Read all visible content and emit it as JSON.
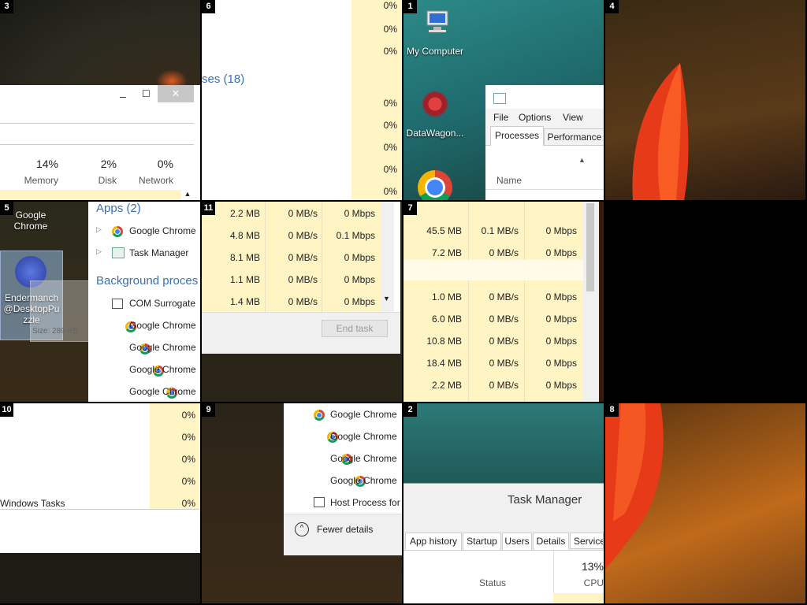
{
  "tiles": {
    "t3": {
      "num": "3",
      "memory_pct": "14%",
      "memory_label": "Memory",
      "disk_pct": "2%",
      "disk_label": "Disk",
      "network_pct": "0%",
      "network_label": "Network"
    },
    "t6": {
      "num": "6",
      "section": "ses (18)",
      "pcts": [
        "0%",
        "0%",
        "0%",
        "0%",
        "0%",
        "0%",
        "0%",
        "0%"
      ]
    },
    "t1": {
      "num": "1",
      "my_computer": "My Computer",
      "datawagon": "DataWagon...",
      "menu": [
        "File",
        "Options",
        "View"
      ],
      "tabs": [
        "Processes",
        "Performance"
      ],
      "name_col": "Name"
    },
    "t4": {
      "num": "4"
    },
    "t5": {
      "num": "5",
      "chrome_label": "Google\nChrome",
      "ender_label": "Endermanch @DesktopPuzzle",
      "apps_header": "Apps (2)",
      "apps": [
        "Google Chrome",
        "Task Manager"
      ],
      "bg_header": "Background proces",
      "bg": [
        "COM Surrogate",
        "Google Chrome",
        "Google Chrome",
        "Google Chrome",
        "Google Chrome"
      ],
      "tooltip": [
        "Size: 289 KB"
      ]
    },
    "t11": {
      "num": "11",
      "rows": [
        [
          "2.2 MB",
          "0 MB/s",
          "0 Mbps"
        ],
        [
          "4.8 MB",
          "0 MB/s",
          "0.1 Mbps"
        ],
        [
          "8.1 MB",
          "0 MB/s",
          "0 Mbps"
        ],
        [
          "1.1 MB",
          "0 MB/s",
          "0 Mbps"
        ],
        [
          "1.4 MB",
          "0 MB/s",
          "0 Mbps"
        ]
      ],
      "end_task": "End task"
    },
    "t7": {
      "num": "7",
      "rows": [
        [
          "45.5 MB",
          "0.1 MB/s",
          "0 Mbps"
        ],
        [
          "7.2 MB",
          "0 MB/s",
          "0 Mbps"
        ],
        [
          "",
          "",
          ""
        ],
        [
          "1.0 MB",
          "0 MB/s",
          "0 Mbps"
        ],
        [
          "6.0 MB",
          "0 MB/s",
          "0 Mbps"
        ],
        [
          "10.8 MB",
          "0 MB/s",
          "0 Mbps"
        ],
        [
          "18.4 MB",
          "0 MB/s",
          "0 Mbps"
        ],
        [
          "2.2 MB",
          "0 MB/s",
          "0 Mbps"
        ]
      ]
    },
    "t10": {
      "num": "10",
      "pcts": [
        "0%",
        "0%",
        "0%",
        "0%",
        "0%"
      ],
      "windows_tasks": "Windows Tasks"
    },
    "t9": {
      "num": "9",
      "procs": [
        "Google Chrome",
        "Google Chrome",
        "Google Chrome",
        "Google Chrome",
        "Host Process for W"
      ],
      "fewer": "Fewer details"
    },
    "t2": {
      "num": "2",
      "title": "Task Manager",
      "tabs": [
        "App history",
        "Startup",
        "Users",
        "Details",
        "Service"
      ],
      "cpu_pct": "13%",
      "status": "Status",
      "cpu": "CPU"
    },
    "t8": {
      "num": "8"
    }
  }
}
